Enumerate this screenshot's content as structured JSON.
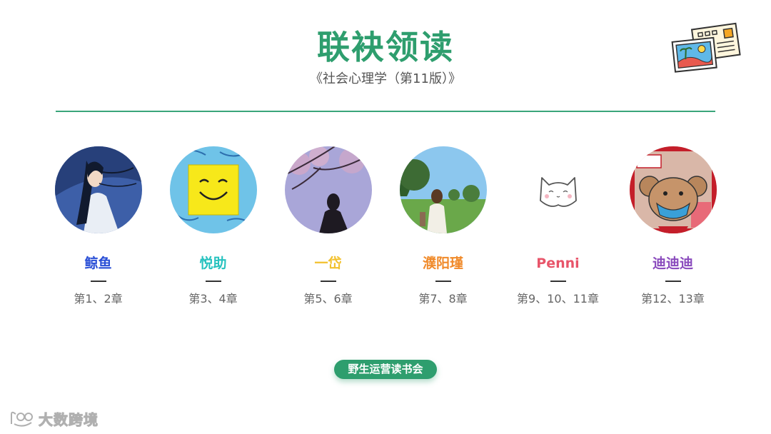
{
  "header": {
    "title": "联袂领读",
    "subtitle": "《社会心理学（第11版）》"
  },
  "members": [
    {
      "name": "鲸鱼",
      "chapters": "第1、2章",
      "color": "#2a4fd6"
    },
    {
      "name": "悦助",
      "chapters": "第3、4章",
      "color": "#27c2bf"
    },
    {
      "name": "一岱",
      "chapters": "第5、6章",
      "color": "#f2c12e"
    },
    {
      "name": "濮阳瑾",
      "chapters": "第7、8章",
      "color": "#f08a2a"
    },
    {
      "name": "Penni",
      "chapters": "第9、10、11章",
      "color": "#e8556a"
    },
    {
      "name": "迪迪迪",
      "chapters": "第12、13章",
      "color": "#8a4bbd"
    }
  ],
  "footer": {
    "badge": "野生运营读书会",
    "watermark": "大数跨境"
  },
  "colors": {
    "accent": "#2e9e6e"
  }
}
